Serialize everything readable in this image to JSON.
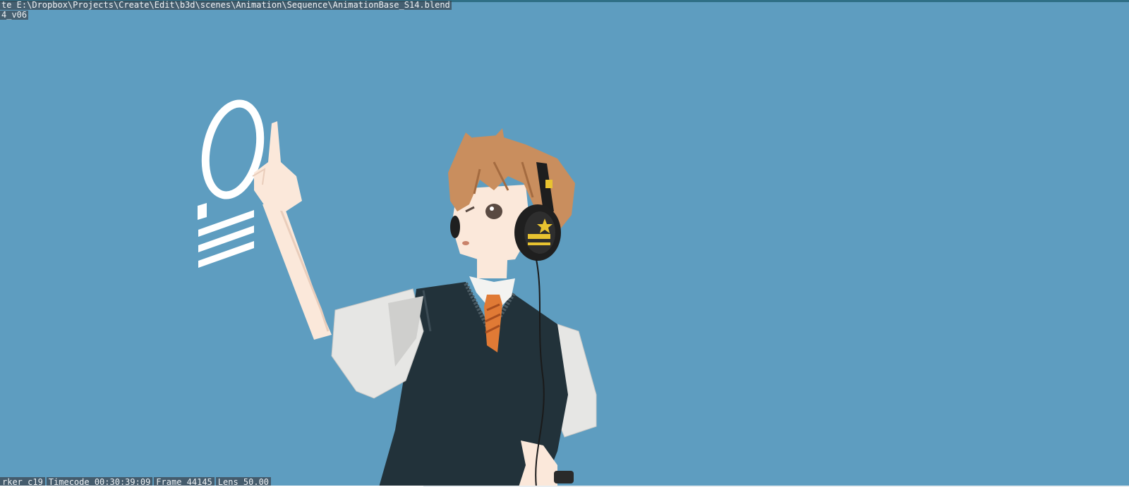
{
  "viewport": {
    "file_path": "te E:\\Dropbox\\Projects\\Create\\Edit\\b3d\\scenes\\Animation\\Sequence\\AnimationBase_S14.blend",
    "version_tag": "4_v06",
    "status": {
      "marker": "rker c19",
      "timecode": "Timecode 00:30:39:09",
      "frame": "Frame 44145",
      "lens": "Lens 50.00"
    }
  },
  "colors": {
    "background": "#5e9dc0",
    "hair": "#c98e5e",
    "skin": "#fbe8da",
    "vest": "#22323a",
    "shirt": "#e6e6e4",
    "tie": "#e07a35",
    "hologram": "#ffffff"
  }
}
